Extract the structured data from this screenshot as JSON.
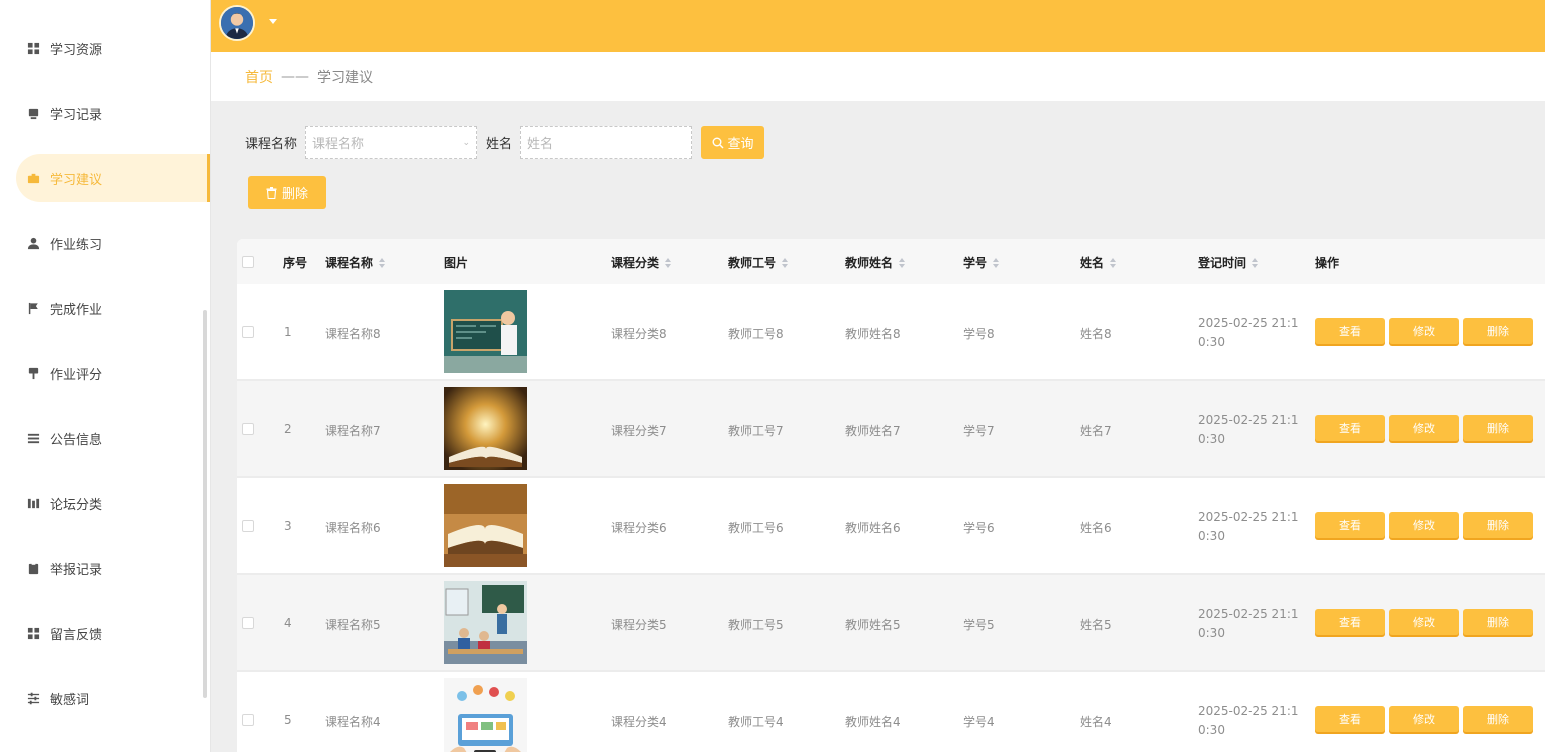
{
  "sidebar": {
    "items": [
      {
        "label": "学习资源",
        "icon": "grid-icon"
      },
      {
        "label": "学习记录",
        "icon": "book-icon"
      },
      {
        "label": "学习建议",
        "icon": "briefcase-icon",
        "active": true
      },
      {
        "label": "作业练习",
        "icon": "user-icon"
      },
      {
        "label": "完成作业",
        "icon": "flag-icon"
      },
      {
        "label": "作业评分",
        "icon": "stamp-icon"
      },
      {
        "label": "公告信息",
        "icon": "list-icon"
      },
      {
        "label": "论坛分类",
        "icon": "columns-icon"
      },
      {
        "label": "举报记录",
        "icon": "clipboard-icon"
      },
      {
        "label": "留言反馈",
        "icon": "grid-icon"
      },
      {
        "label": "敏感词",
        "icon": "sliders-icon"
      }
    ]
  },
  "breadcrumb": {
    "home": "首页",
    "separator": "——",
    "current": "学习建议"
  },
  "search": {
    "course_label": "课程名称",
    "course_placeholder": "课程名称",
    "name_label": "姓名",
    "name_placeholder": "姓名",
    "query_button": "查询"
  },
  "toolbar": {
    "delete_button": "删除"
  },
  "table": {
    "headers": [
      "序号",
      "课程名称",
      "图片",
      "课程分类",
      "教师工号",
      "教师姓名",
      "学号",
      "姓名",
      "登记时间",
      "操作"
    ],
    "rows": [
      {
        "index": "1",
        "course": "课程名称8",
        "category": "课程分类8",
        "teacher_id": "教师工号8",
        "teacher_name": "教师姓名8",
        "student_id": "学号8",
        "name": "姓名8",
        "time": "2025-02-25 21:10:30",
        "image": "classroom-teacher-image"
      },
      {
        "index": "2",
        "course": "课程名称7",
        "category": "课程分类7",
        "teacher_id": "教师工号7",
        "teacher_name": "教师姓名7",
        "student_id": "学号7",
        "name": "姓名7",
        "time": "2025-02-25 21:10:30",
        "image": "open-book-glow-image"
      },
      {
        "index": "3",
        "course": "课程名称6",
        "category": "课程分类6",
        "teacher_id": "教师工号6",
        "teacher_name": "教师姓名6",
        "student_id": "学号6",
        "name": "姓名6",
        "time": "2025-02-25 21:10:30",
        "image": "open-book-image"
      },
      {
        "index": "4",
        "course": "课程名称5",
        "category": "课程分类5",
        "teacher_id": "教师工号5",
        "teacher_name": "教师姓名5",
        "student_id": "学号5",
        "name": "姓名5",
        "time": "2025-02-25 21:10:30",
        "image": "students-classroom-image"
      },
      {
        "index": "5",
        "course": "课程名称4",
        "category": "课程分类4",
        "teacher_id": "教师工号4",
        "teacher_name": "教师姓名4",
        "student_id": "学号4",
        "name": "姓名4",
        "time": "2025-02-25 21:10:30",
        "image": "e-learning-image"
      }
    ],
    "actions": {
      "view": "查看",
      "edit": "修改",
      "delete": "删除"
    }
  },
  "colors": {
    "accent": "#fdc03f",
    "active_bg": "#fff3d9",
    "content_bg": "#eeeeee"
  }
}
